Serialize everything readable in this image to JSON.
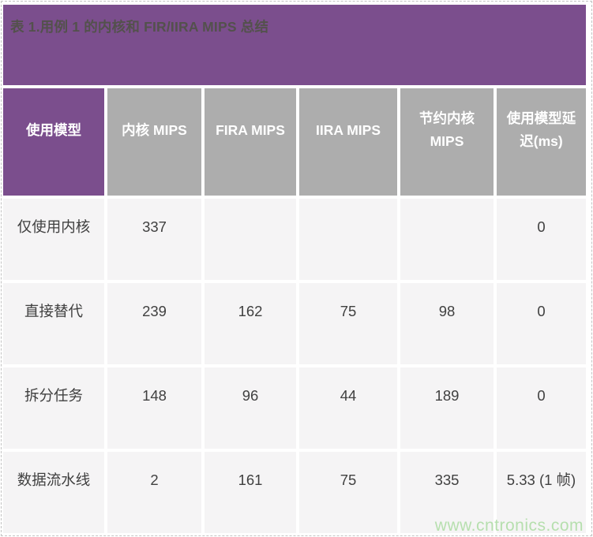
{
  "title": "表 1.用例 1 的内核和 FIR/IIRA MIPS 总结",
  "colors": {
    "accent_purple": "#7b4e8d",
    "header_gray": "#adadad",
    "header_text": "#ffffff",
    "title_text": "#53514c",
    "row_bg": "#f5f4f5",
    "data_text": "#404040",
    "watermark_green": "#b6dfae"
  },
  "table": {
    "columns": [
      "使用模型",
      "内核 MIPS",
      "FIRA MIPS",
      "IIRA MIPS",
      "节约内核\nMIPS",
      "使用模型延\n迟(ms)"
    ],
    "rows": [
      [
        "仅使用内核",
        "337",
        "",
        "",
        "",
        "0"
      ],
      [
        "直接替代",
        "239",
        "162",
        "75",
        "98",
        "0"
      ],
      [
        "拆分任务",
        "148",
        "96",
        "44",
        "189",
        "0"
      ],
      [
        "数据流水线",
        "2",
        "161",
        "75",
        "335",
        "5.33 (1 帧)"
      ]
    ]
  },
  "watermark": "www.cntronics.com"
}
